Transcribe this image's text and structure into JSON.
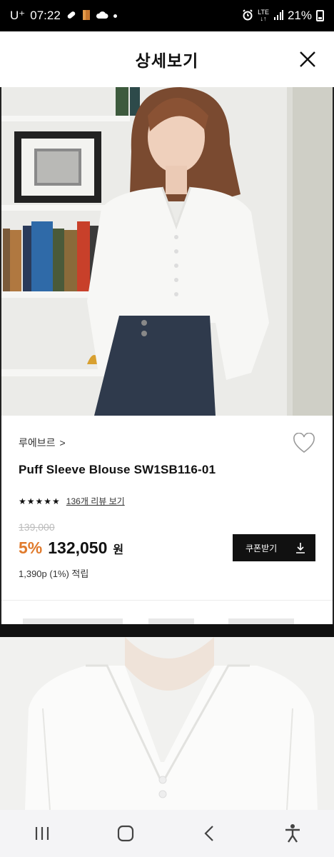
{
  "status_bar": {
    "carrier": "U⁺",
    "time": "07:22",
    "network": "LTE",
    "battery": "21%"
  },
  "header": {
    "title": "상세보기"
  },
  "product": {
    "brand": "루에브르",
    "brand_chevron": ">",
    "name": "Puff Sleeve Blouse SW1SB116-01",
    "stars": "★★★★★",
    "rating_fraction": 1.0,
    "review_link": "136개 리뷰 보기",
    "original_price": "139,000",
    "discount": "5%",
    "price": "132,050",
    "currency": "원",
    "points": "1,390p (1%) 적립",
    "coupon_button": "쿠폰받기"
  },
  "colors": {
    "discount": "#e07a2c",
    "coupon_bg": "#111111"
  },
  "icons": {
    "close": "close-icon",
    "heart": "heart-icon",
    "download": "download-icon",
    "recent_apps": "recent-apps-icon",
    "home": "home-icon",
    "back": "back-icon",
    "accessibility": "accessibility-icon"
  }
}
